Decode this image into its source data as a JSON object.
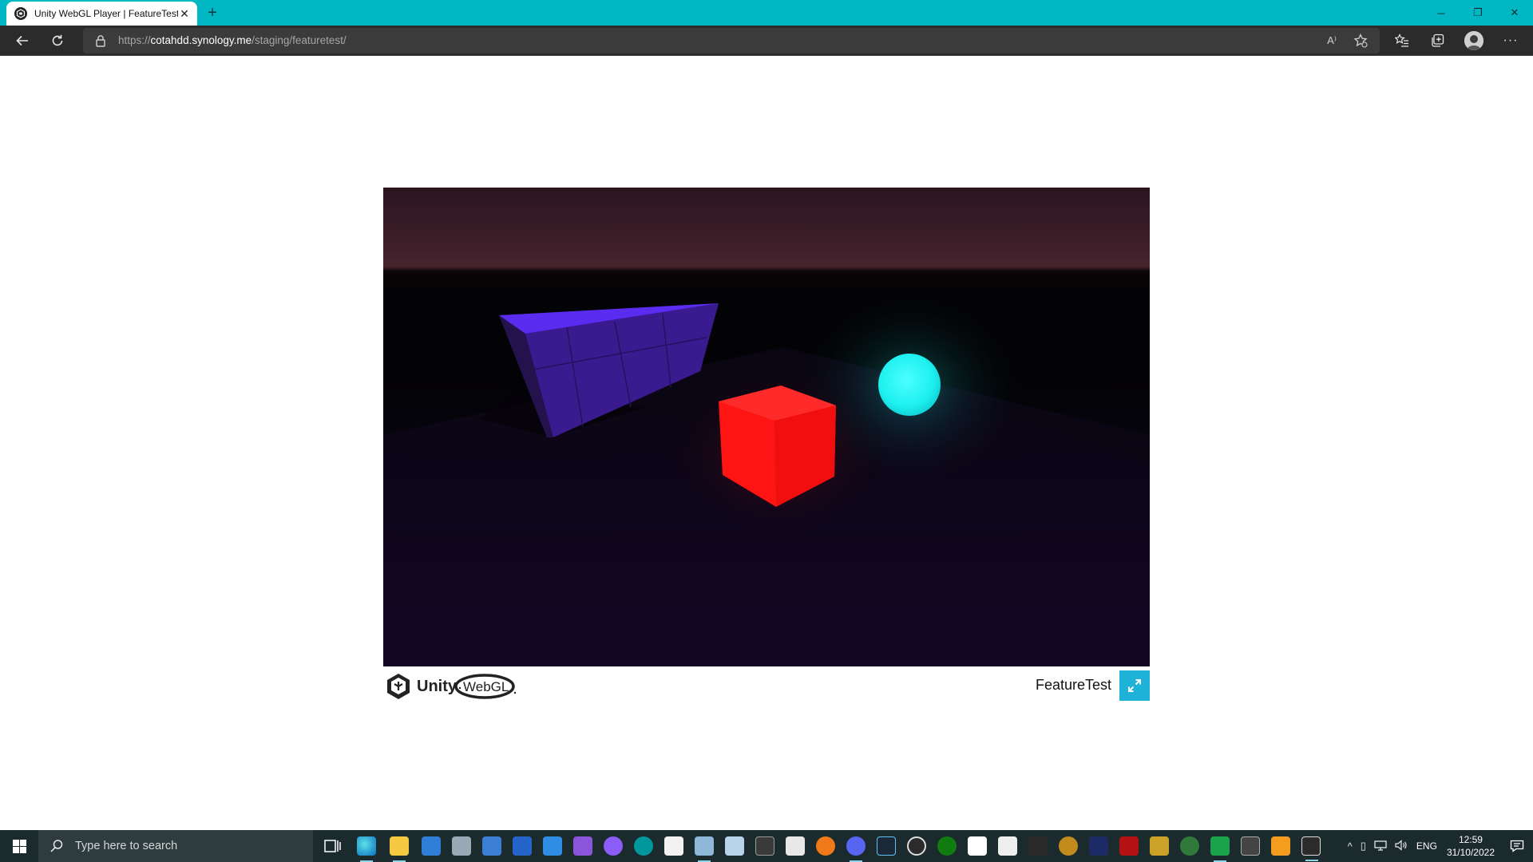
{
  "browser": {
    "tab": {
      "title": "Unity WebGL Player | FeatureTest",
      "close_glyph": "✕",
      "favicon": "unity-icon"
    },
    "new_tab_glyph": "+",
    "window_controls": {
      "minimize": "─",
      "restore": "❐",
      "close": "✕"
    },
    "address": {
      "scheme": "https://",
      "host": "cotahdd.synology.me",
      "path": "/staging/featuretest/"
    },
    "toolbar_icons": [
      "back-icon",
      "refresh-icon",
      "lock-icon",
      "read-aloud-icon",
      "add-favorite-icon",
      "favorites-icon",
      "collections-icon",
      "profile-icon",
      "more-icon"
    ],
    "read_aloud_glyph": "A⁾",
    "more_glyph": "···"
  },
  "page": {
    "build_title": "FeatureTest",
    "logo": {
      "unity": "Unity",
      "webgl": "WebGL"
    },
    "scene": {
      "objects": [
        {
          "name": "purple-wall-block",
          "color": "#4a1fd1"
        },
        {
          "name": "red-cube",
          "color": "#ff1a1a"
        },
        {
          "name": "cyan-sphere",
          "color": "#22f2f2"
        }
      ]
    },
    "colors": {
      "fullscreen_button": "#1fb2d8",
      "titlebar": "#00b7c3"
    }
  },
  "taskbar": {
    "search_placeholder": "Type here to search",
    "apps": [
      "edge",
      "file-explorer",
      "store",
      "mail",
      "remote-desktop",
      "outlook",
      "vscode",
      "visual-studio",
      "github",
      "arduino",
      "excel",
      "paint",
      "notepad",
      "terminal",
      "editor",
      "blender",
      "discord",
      "steam",
      "obs",
      "xbox",
      "unity-hub",
      "acrobat",
      "game",
      "world-of-warcraft",
      "app",
      "app2",
      "app3",
      "app4",
      "chat",
      "visual-studio-code",
      "media",
      "unity"
    ],
    "tray": {
      "chevron": "^",
      "language": "ENG",
      "time": "12:59",
      "date": "31/10/2022"
    }
  }
}
